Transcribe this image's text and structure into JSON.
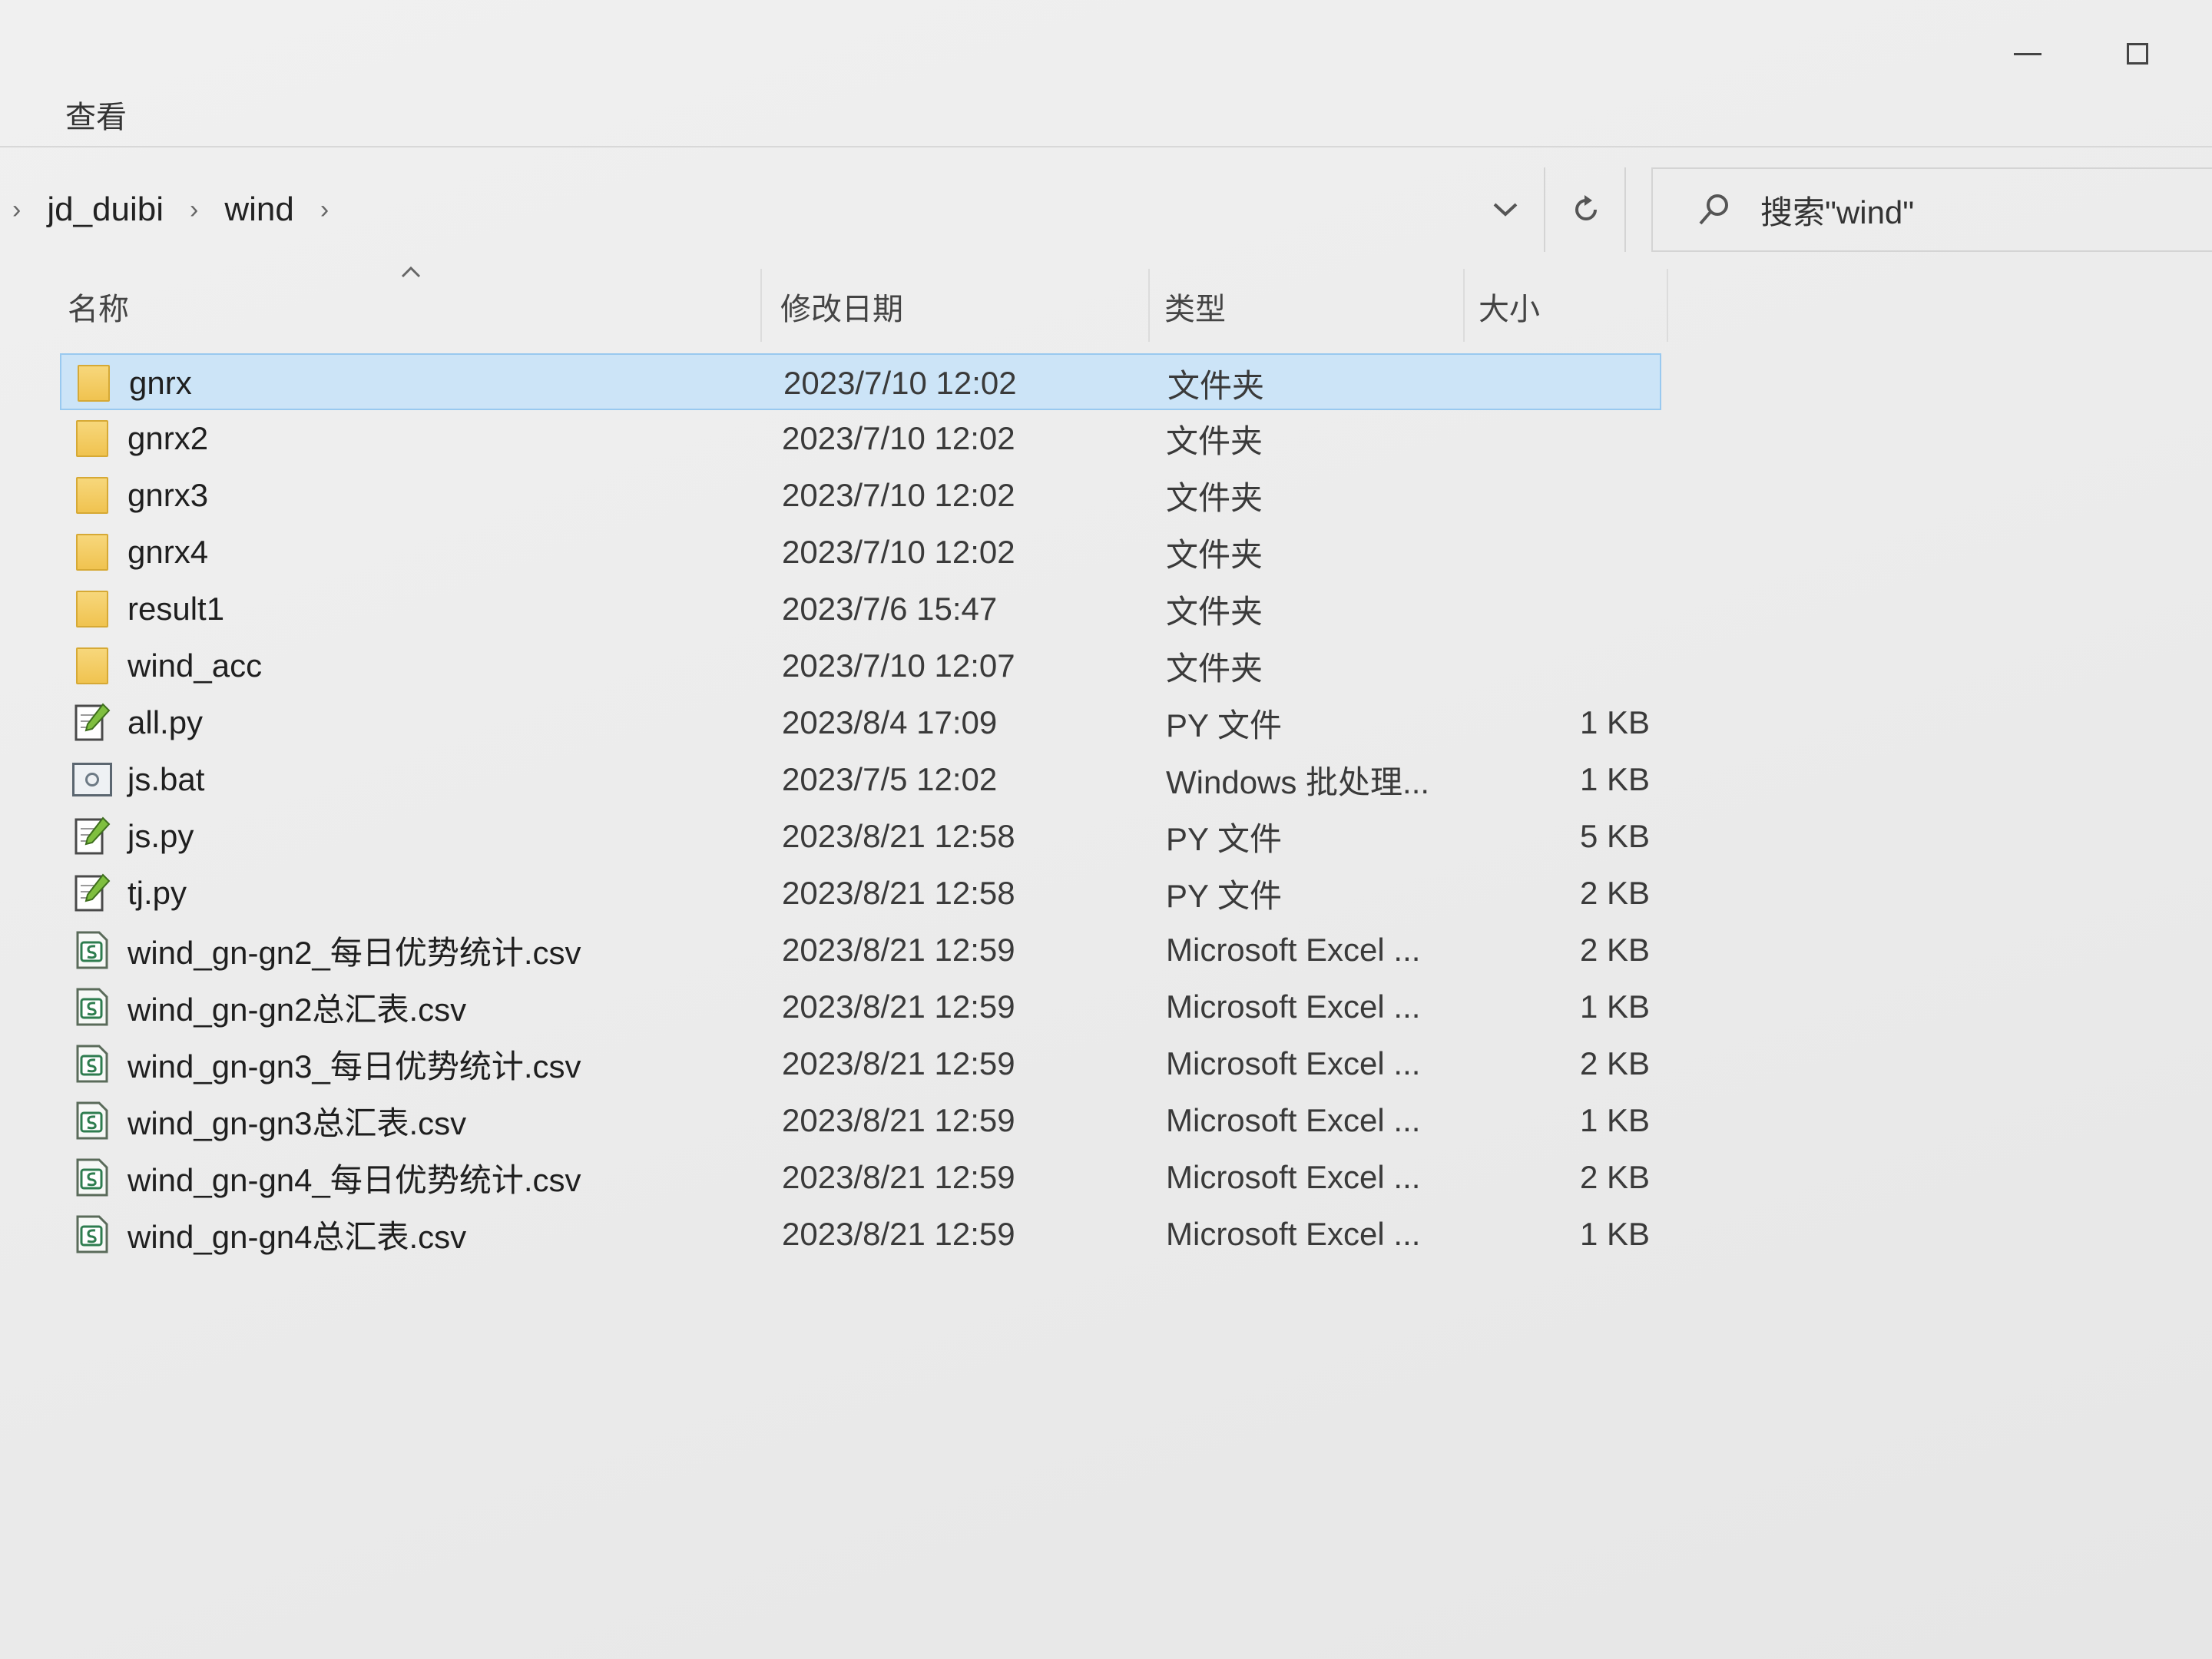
{
  "ribbon": {
    "view_tab": "查看"
  },
  "address": {
    "crumbs": [
      "jd_duibi",
      "wind"
    ],
    "search_placeholder": "搜索\"wind\""
  },
  "columns": {
    "name": "名称",
    "date": "修改日期",
    "type": "类型",
    "size": "大小"
  },
  "files": [
    {
      "name": "gnrx",
      "date": "2023/7/10 12:02",
      "type": "文件夹",
      "size": "",
      "icon": "folder-icon",
      "selected": true
    },
    {
      "name": "gnrx2",
      "date": "2023/7/10 12:02",
      "type": "文件夹",
      "size": "",
      "icon": "folder-icon"
    },
    {
      "name": "gnrx3",
      "date": "2023/7/10 12:02",
      "type": "文件夹",
      "size": "",
      "icon": "folder-icon"
    },
    {
      "name": "gnrx4",
      "date": "2023/7/10 12:02",
      "type": "文件夹",
      "size": "",
      "icon": "folder-icon"
    },
    {
      "name": "result1",
      "date": "2023/7/6 15:47",
      "type": "文件夹",
      "size": "",
      "icon": "folder-icon"
    },
    {
      "name": "wind_acc",
      "date": "2023/7/10 12:07",
      "type": "文件夹",
      "size": "",
      "icon": "folder-icon"
    },
    {
      "name": "all.py",
      "date": "2023/8/4 17:09",
      "type": "PY 文件",
      "size": "1 KB",
      "icon": "python-file-icon"
    },
    {
      "name": "js.bat",
      "date": "2023/7/5 12:02",
      "type": "Windows 批处理...",
      "size": "1 KB",
      "icon": "batch-file-icon"
    },
    {
      "name": "js.py",
      "date": "2023/8/21 12:58",
      "type": "PY 文件",
      "size": "5 KB",
      "icon": "python-file-icon"
    },
    {
      "name": "tj.py",
      "date": "2023/8/21 12:58",
      "type": "PY 文件",
      "size": "2 KB",
      "icon": "python-file-icon"
    },
    {
      "name": "wind_gn-gn2_每日优势统计.csv",
      "date": "2023/8/21 12:59",
      "type": "Microsoft Excel ...",
      "size": "2 KB",
      "icon": "excel-csv-icon"
    },
    {
      "name": "wind_gn-gn2总汇表.csv",
      "date": "2023/8/21 12:59",
      "type": "Microsoft Excel ...",
      "size": "1 KB",
      "icon": "excel-csv-icon"
    },
    {
      "name": "wind_gn-gn3_每日优势统计.csv",
      "date": "2023/8/21 12:59",
      "type": "Microsoft Excel ...",
      "size": "2 KB",
      "icon": "excel-csv-icon"
    },
    {
      "name": "wind_gn-gn3总汇表.csv",
      "date": "2023/8/21 12:59",
      "type": "Microsoft Excel ...",
      "size": "1 KB",
      "icon": "excel-csv-icon"
    },
    {
      "name": "wind_gn-gn4_每日优势统计.csv",
      "date": "2023/8/21 12:59",
      "type": "Microsoft Excel ...",
      "size": "2 KB",
      "icon": "excel-csv-icon"
    },
    {
      "name": "wind_gn-gn4总汇表.csv",
      "date": "2023/8/21 12:59",
      "type": "Microsoft Excel ...",
      "size": "1 KB",
      "icon": "excel-csv-icon"
    }
  ]
}
